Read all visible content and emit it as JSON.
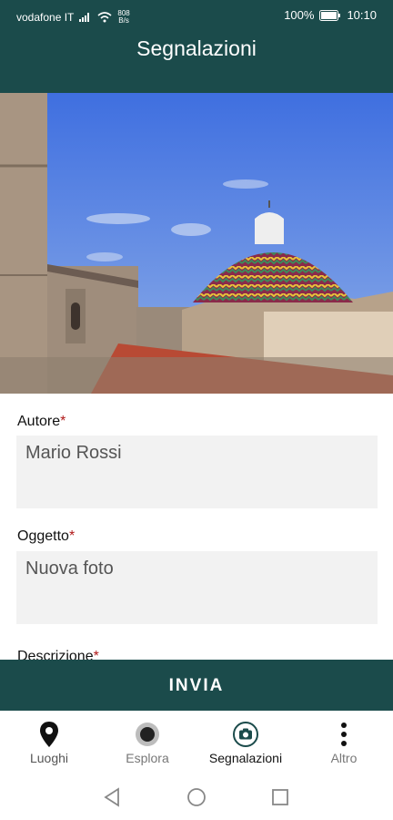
{
  "status_bar": {
    "carrier": "vodafone IT",
    "speed_value": "808",
    "speed_unit": "B/s",
    "battery": "100%",
    "time": "10:10"
  },
  "app_bar": {
    "title": "Segnalazioni"
  },
  "form": {
    "author_label": "Autore",
    "author_value": "Mario Rossi",
    "subject_label": "Oggetto",
    "subject_value": "Nuova foto",
    "description_label": "Descrizione",
    "required_marker": "*"
  },
  "submit_label": "INVIA",
  "bottom_nav": {
    "items": [
      {
        "label": "Luoghi",
        "icon": "map-pin-icon"
      },
      {
        "label": "Esplora",
        "icon": "record-icon"
      },
      {
        "label": "Segnalazioni",
        "icon": "camera-icon",
        "active": true
      },
      {
        "label": "Altro",
        "icon": "more-vertical-icon"
      }
    ]
  },
  "colors": {
    "primary": "#1b4b4b",
    "required": "#b01818",
    "field_bg": "#f2f2f2"
  }
}
